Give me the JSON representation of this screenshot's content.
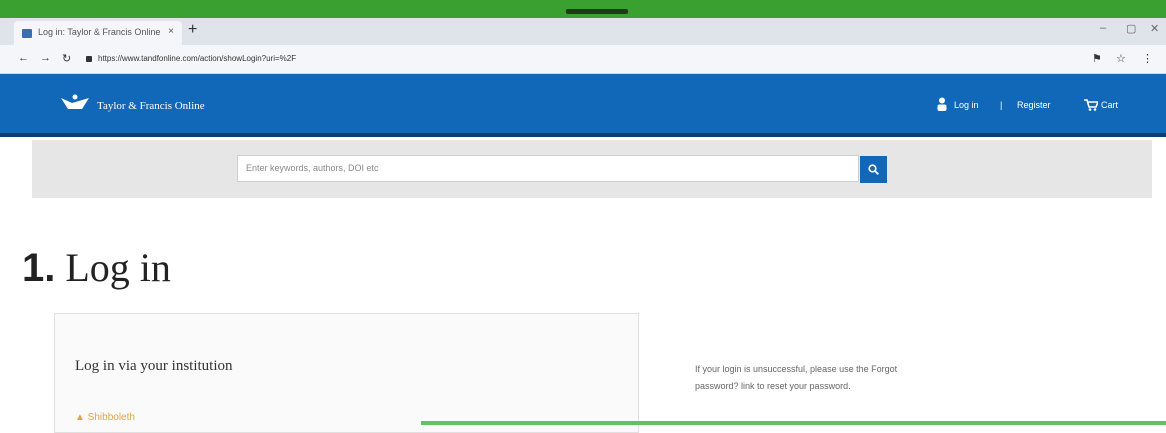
{
  "browser": {
    "tab_title": "Log in: Taylor & Francis Online",
    "tab_close": "×",
    "new_tab": "+",
    "window_controls": [
      "–",
      "▢",
      "✕"
    ],
    "nav": {
      "back": "←",
      "forward": "→",
      "reload": "↻"
    },
    "address": "https://www.tandfonline.com/action/showLogin?uri=%2F",
    "toolbar_icons": [
      "⚑",
      "☆",
      "⋮"
    ]
  },
  "header": {
    "brand": "Taylor & Francis Online",
    "login": "Log in",
    "separator": "|",
    "register": "Register",
    "cart": "Cart"
  },
  "search": {
    "placeholder": "Enter keywords, authors, DOI etc"
  },
  "page": {
    "step_number": "1.",
    "title": "Log in"
  },
  "login_card": {
    "title": "Log in via your institution",
    "shibboleth": "▲ Shibboleth"
  },
  "help": {
    "text": "If your login is unsuccessful, please use the Forgot password? link to reset your password."
  },
  "colors": {
    "header_blue": "#1168b8",
    "os_bar_green": "#3aa02f",
    "accent_orange": "#e0a44a"
  }
}
